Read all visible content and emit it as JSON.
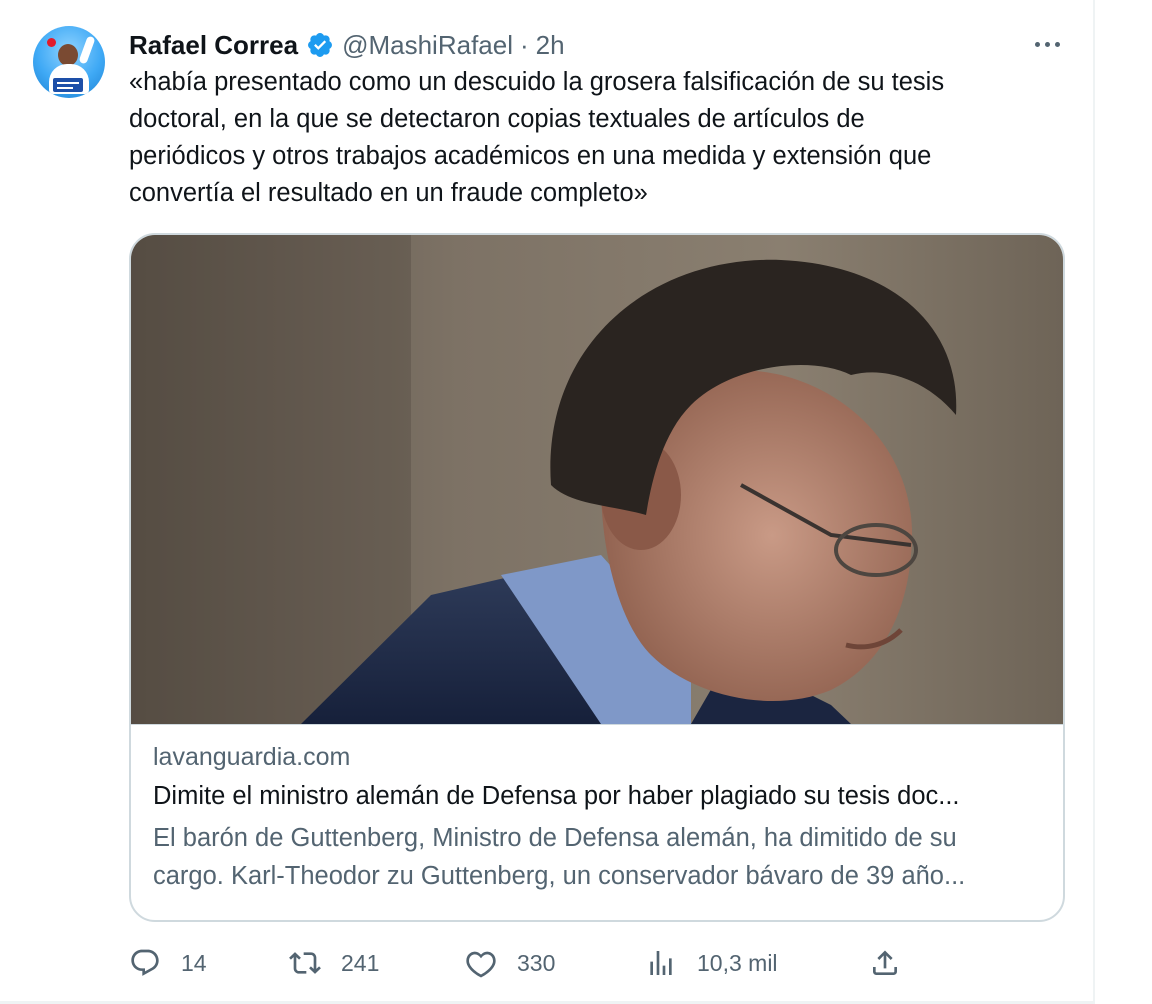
{
  "tweet": {
    "author_name": "Rafael Correa",
    "handle": "@MashiRafael",
    "separator": "·",
    "time": "2h",
    "text_lines": [
      "«había presentado como un descuido la grosera falsificación de su tesis",
      "doctoral, en la que se detectaron copias textuales de artículos de",
      "periódicos y otros trabajos académicos en una medida y extensión que",
      "convertía el resultado en un fraude completo»"
    ]
  },
  "card": {
    "domain": "lavanguardia.com",
    "title": "Dimite el ministro alemán de Defensa por haber plagiado su tesis doc...",
    "description_lines": [
      "El barón de Guttenberg, Ministro de Defensa alemán, ha dimitido de su",
      "cargo. Karl-Theodor zu Guttenberg, un conservador bávaro de 39 año..."
    ]
  },
  "actions": {
    "replies": "14",
    "retweets": "241",
    "likes": "330",
    "views": "10,3 mil"
  },
  "icons": {
    "verified": "verified-badge-icon",
    "more": "more-horizontal-icon",
    "reply": "reply-icon",
    "retweet": "retweet-icon",
    "like": "heart-icon",
    "views": "views-chart-icon",
    "share": "share-icon"
  },
  "colors": {
    "text_primary": "#0f1419",
    "text_secondary": "#536471",
    "verified_blue": "#1d9bf0",
    "border": "#cfd9de"
  }
}
